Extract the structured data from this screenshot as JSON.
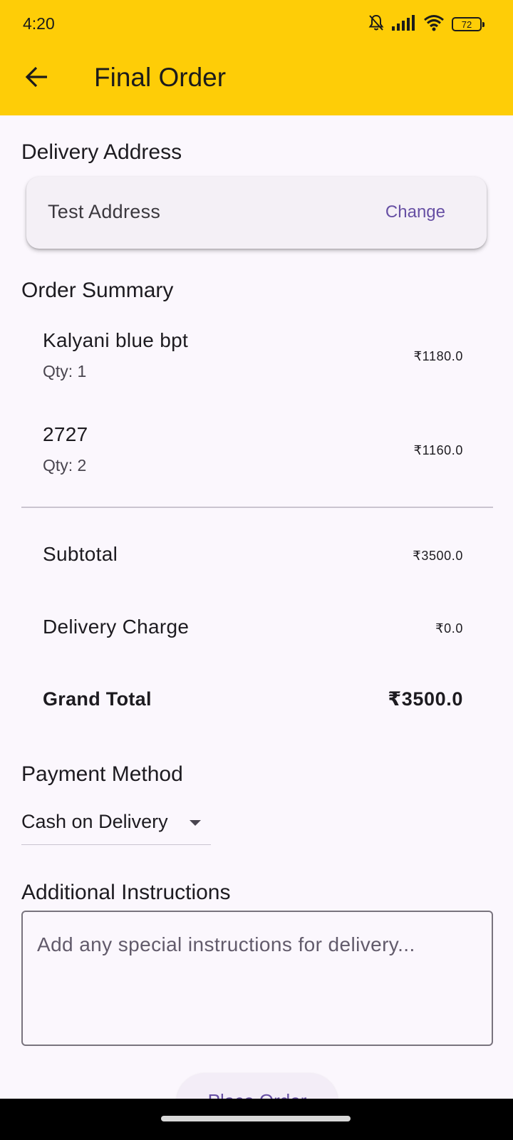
{
  "status_bar": {
    "time": "4:20",
    "battery": "72",
    "icons": [
      "bell-muted-icon",
      "signal-icon",
      "wifi-icon",
      "battery-icon"
    ]
  },
  "app_bar": {
    "title": "Final Order",
    "background": "#fecd07",
    "back_icon": "arrow-left-icon"
  },
  "delivery_address": {
    "heading": "Delivery Address",
    "address": "Test Address",
    "change_label": "Change"
  },
  "order_summary": {
    "heading": "Order Summary",
    "items": [
      {
        "name": "Kalyani blue bpt",
        "qty": "Qty: 1",
        "price": "₹1180.0"
      },
      {
        "name": "2727",
        "qty": "Qty: 2",
        "price": "₹1160.0"
      }
    ],
    "subtotal_label": "Subtotal",
    "subtotal_value": "₹3500.0",
    "delivery_label": "Delivery Charge",
    "delivery_value": "₹0.0",
    "grand_total_label": "Grand Total",
    "grand_total_value": "₹3500.0"
  },
  "payment": {
    "heading": "Payment Method",
    "selected": "Cash on Delivery"
  },
  "instructions": {
    "heading": "Additional Instructions",
    "placeholder": "Add any special instructions for delivery..."
  },
  "place_order": {
    "label": "Place Order"
  },
  "colors": {
    "accent": "#6750a4",
    "page_background": "#fbf7fd"
  }
}
